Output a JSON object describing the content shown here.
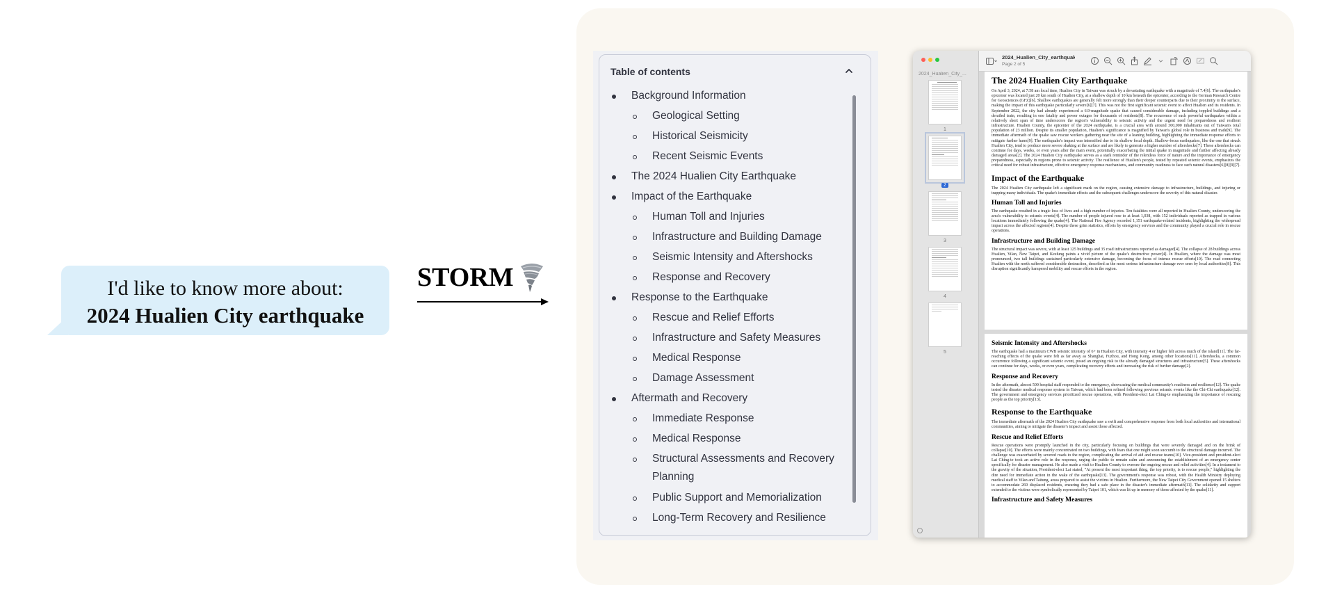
{
  "prompt": {
    "line1": "I'd like to know more about:",
    "line2": "2024 Hualien City earthquake"
  },
  "storm": {
    "label": "STORM",
    "icon": "tornado-icon"
  },
  "toc": {
    "title": "Table of contents",
    "items": [
      {
        "level": 1,
        "text": "Background Information"
      },
      {
        "level": 2,
        "text": "Geological Setting"
      },
      {
        "level": 2,
        "text": "Historical Seismicity"
      },
      {
        "level": 2,
        "text": "Recent Seismic Events"
      },
      {
        "level": 1,
        "text": "The 2024 Hualien City Earthquake"
      },
      {
        "level": 1,
        "text": "Impact of the Earthquake"
      },
      {
        "level": 2,
        "text": "Human Toll and Injuries"
      },
      {
        "level": 2,
        "text": "Infrastructure and Building Damage"
      },
      {
        "level": 2,
        "text": "Seismic Intensity and Aftershocks"
      },
      {
        "level": 2,
        "text": "Response and Recovery"
      },
      {
        "level": 1,
        "text": "Response to the Earthquake"
      },
      {
        "level": 2,
        "text": "Rescue and Relief Efforts"
      },
      {
        "level": 2,
        "text": "Infrastructure and Safety Measures"
      },
      {
        "level": 2,
        "text": "Medical Response"
      },
      {
        "level": 2,
        "text": "Damage Assessment"
      },
      {
        "level": 1,
        "text": "Aftermath and Recovery"
      },
      {
        "level": 2,
        "text": "Immediate Response"
      },
      {
        "level": 2,
        "text": "Medical Response"
      },
      {
        "level": 2,
        "text": "Structural Assessments and Recovery Planning"
      },
      {
        "level": 2,
        "text": "Public Support and Memorialization"
      },
      {
        "level": 2,
        "text": "Long-Term Recovery and Resilience"
      }
    ]
  },
  "pdf": {
    "sidebar_file": "2024_Hualien_City_...",
    "toolbar_file": "2024_Hualien_City_earthquake_st...",
    "toolbar_page": "Page 2 of 5",
    "thumbnails": [
      "1",
      "2",
      "3",
      "4",
      "5"
    ],
    "selected_thumbnail": "2",
    "page1": {
      "title": "The 2024 Hualien City Earthquake",
      "p1": "On April 3, 2024, at 7:58 am local time, Hualien City in Taiwan was struck by a devastating earthquake with a magnitude of 7.4[6]. The earthquake's epicenter was located just 20 km south of Hualien City, at a shallow depth of 10 km beneath the epicenter, according to the German Research Centre for Geosciences (GFZ)[6]. Shallow earthquakes are generally felt more strongly than their deeper counterparts due to their proximity to the surface, making the impact of this earthquake particularly severe[6][7]. This was not the first significant seismic event to affect Hualien and its residents. In September 2022, the city had already experienced a 6.9-magnitude quake that caused considerable damage, including toppled buildings and a derailed train, resulting in one fatality and power outages for thousands of residents[8]. The recurrence of such powerful earthquakes within a relatively short span of time underscores the region's vulnerability to seismic activity and the urgent need for preparedness and resilient infrastructure. Hualien County, the epicenter of the 2024 earthquake, is a crucial area with around 300,000 inhabitants out of Taiwan's total population of 23 million. Despite its smaller population, Hualien's significance is magnified by Taiwan's global role in business and trade[9]. The immediate aftermath of the quake saw rescue workers gathering near the site of a leaning building, highlighting the immediate response efforts to mitigate further harm[9]. The earthquake's impact was intensified due to its shallow focal depth. Shallow-focus earthquakes, like the one that struck Hualien City, tend to produce more severe shaking at the surface and are likely to generate a higher number of aftershocks[7]. These aftershocks can continue for days, weeks, or even years after the main event, potentially exacerbating the initial quake in magnitude and further affecting already damaged areas[2]. The 2024 Hualien City earthquake serves as a stark reminder of the relentless force of nature and the importance of emergency preparedness, especially in regions prone to seismic activity. The resilience of Hualien's people, tested by repeated seismic events, emphasizes the critical need for robust infrastructure, effective emergency response mechanisms, and community readiness to face such natural disasters[6][8][9][7].",
      "h_impact": "Impact of the Earthquake",
      "p_impact": "The 2024 Hualien City earthquake left a significant mark on the region, causing extensive damage to infrastructure, buildings, and injuring or trapping many individuals. The quake's immediate effects and the subsequent challenges underscore the severity of this natural disaster.",
      "h_human": "Human Toll and Injuries",
      "p_human": "The earthquake resulted in a tragic loss of lives and a high number of injuries. Ten fatalities were all reported in Hualien County, underscoring the area's vulnerability to seismic events[4]. The number of people injured rose to at least 1,038, with 152 individuals reported as trapped in various locations immediately following the quake[4]. The National Fire Agency recorded 1,151 earthquake-related incidents, highlighting the widespread impact across the affected regions[4]. Despite these grim statistics, efforts by emergency services and the community played a crucial role in rescue operations.",
      "h_infra": "Infrastructure and Building Damage",
      "p_infra": "The structural impact was severe, with at least 125 buildings and 35 road infrastructures reported as damaged[4]. The collapse of 28 buildings across Hualien, Yilan, New Taipei, and Keelung paints a vivid picture of the quake's destructive power[4]. In Hualien, where the damage was most pronounced, two tall buildings sustained particularly extensive damage, becoming the focus of intense rescue efforts[10]. The road connecting Hualien with the north suffered considerable destruction, described as the most serious infrastructure damage ever seen by local authorities[8]. This disruption significantly hampered mobility and rescue efforts in the region."
    },
    "page2": {
      "h_seismic": "Seismic Intensity and Aftershocks",
      "p_seismic": "The earthquake had a maximum CWB seismic intensity of 6+ in Hualien City, with intensity 4 or higher felt across much of the island[11]. The far-reaching effects of the quake were felt as far away as Shanghai, Fuzhou, and Hong Kong, among other locations[11]. Aftershocks, a common occurrence following a significant seismic event, posed an ongoing risk to the already damaged structures and infrastructure[5]. These aftershocks can continue for days, weeks, or even years, complicating recovery efforts and increasing the risk of further damage[2].",
      "h_response": "Response and Recovery",
      "p_response": "In the aftermath, almost 500 hospital staff responded to the emergency, showcasing the medical community's readiness and resilience[12]. The quake tested the disaster medical response system in Taiwan, which had been refined following previous seismic events like the Chi-Chi earthquake[12]. The government and emergency services prioritized rescue operations, with President-elect Lai Ching-te emphasizing the importance of rescuing people as the top priority[13].",
      "h_resp_eq": "Response to the Earthquake",
      "p_resp_eq": "The immediate aftermath of the 2024 Hualien City earthquake saw a swift and comprehensive response from both local authorities and international communities, aiming to mitigate the disaster's impact and assist those affected.",
      "h_rescue": "Rescue and Relief Efforts",
      "p_rescue": "Rescue operations were promptly launched in the city, particularly focusing on buildings that were severely damaged and on the brink of collapse[10]. The efforts were mainly concentrated on two buildings, with fears that one might soon succumb to the structural damage incurred. The challenge was exacerbated by severed roads to the region, complicating the arrival of aid and rescue teams[10]. Vice-president and president-elect Lai Ching-te took an active role in the response, urging the public to remain calm and announcing the establishment of an emergency center specifically for disaster management. He also made a visit to Hualien County to oversee the ongoing rescue and relief activities[4]. In a testament to the gravity of the situation, President-elect Lai stated, \"At present the most important thing, the top priority, is to rescue people,\" highlighting the dire need for immediate action in the wake of the earthquake[13]. The government's response was robust, with the Health Ministry deploying medical staff to Yilan and Taitung, areas prepared to assist the victims in Hualien. Furthermore, the New Taipei City Government opened 15 shelters to accommodate 269 displaced residents, ensuring they had a safe place in the disaster's immediate aftermath[11]. The solidarity and support extended to the victims were symbolically represented by Taipei 101, which was lit up in memory of those affected by the quake[11].",
      "h_safety": "Infrastructure and Safety Measures"
    }
  },
  "colors": {
    "bubble_bg": "#dceffa",
    "panel_bg": "#faf7f1",
    "toc_bg": "#f0f1f5",
    "accent_blue": "#2b67d5"
  }
}
